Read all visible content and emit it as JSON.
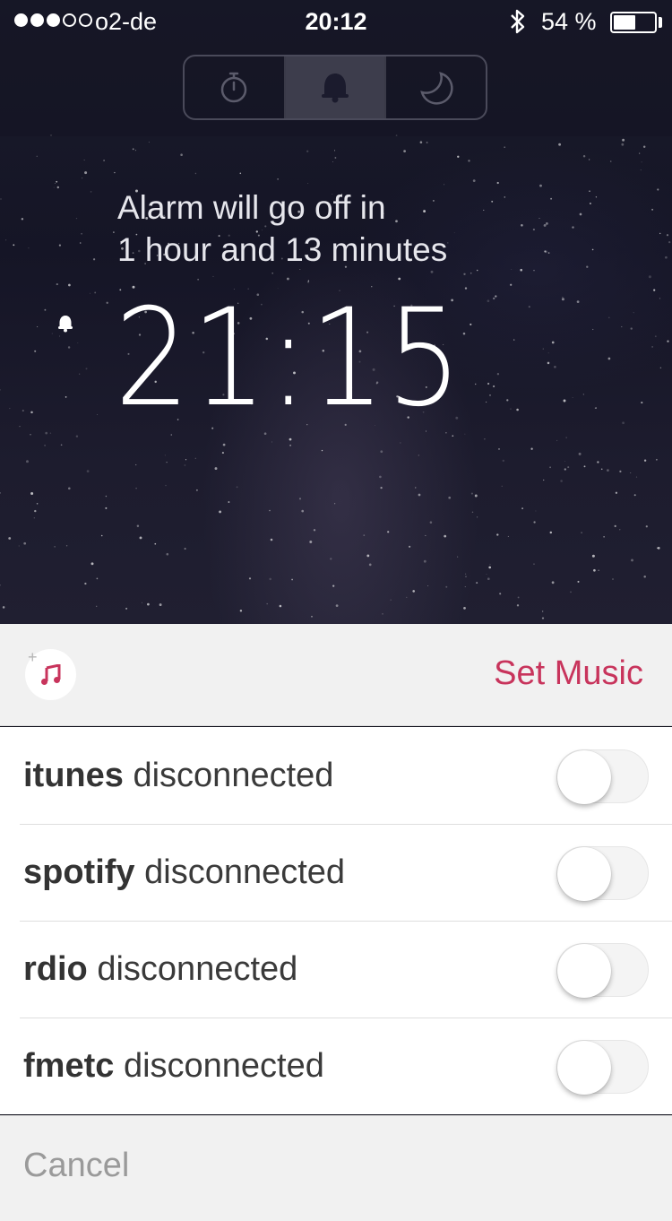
{
  "status_bar": {
    "carrier": "o2-de",
    "signal_bars_filled": 3,
    "signal_bars_total": 5,
    "time": "20:12",
    "battery_percent_label": "54 %",
    "battery_level": 0.54,
    "bluetooth_icon": "bluetooth-icon"
  },
  "mode_selector": {
    "segments": [
      {
        "icon": "stopwatch-icon",
        "active": false
      },
      {
        "icon": "bell-icon",
        "active": true
      },
      {
        "icon": "moon-icon",
        "active": false
      }
    ]
  },
  "alarm": {
    "caption_line1": "Alarm will go off in",
    "caption_line2": "1 hour and 13 minutes",
    "time": "21:15",
    "indicator_icon": "bell-icon"
  },
  "music_sheet": {
    "icon": "add-music-icon",
    "plus": "+",
    "set_music_label": "Set Music",
    "accent_color": "#c8345c",
    "services": [
      {
        "name": "itunes",
        "status": "disconnected",
        "enabled": false
      },
      {
        "name": "spotify",
        "status": "disconnected",
        "enabled": false
      },
      {
        "name": "rdio",
        "status": "disconnected",
        "enabled": false
      },
      {
        "name": "fmetc",
        "status": "disconnected",
        "enabled": false
      }
    ],
    "cancel_label": "Cancel"
  }
}
